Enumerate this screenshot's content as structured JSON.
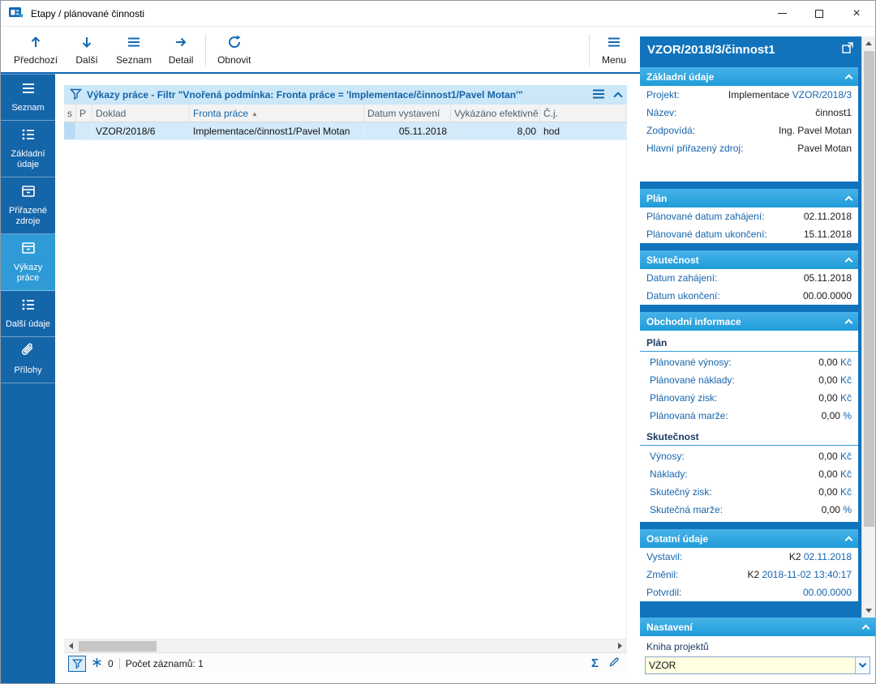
{
  "window": {
    "title": "Etapy / plánované činnosti",
    "controls": {
      "close_glyph": "×"
    }
  },
  "accents": {
    "primary_blue": "#1268B4",
    "sidebar_blue": "#1565A9",
    "sidebar_selected": "#2E9AD6",
    "panel_background": "#1173BC",
    "section_header": "#2AA5DF",
    "filter_bar": "#CBE7F8",
    "row_highlight": "#D3EAFA",
    "combo_background": "#FFFFE1"
  },
  "icons": {
    "close": "×",
    "sort_asc": "▲",
    "sum": "Σ"
  },
  "toolbar": {
    "prev": "Předchozí",
    "next": "Další",
    "list": "Seznam",
    "detail": "Detail",
    "refresh": "Obnovit",
    "menu": "Menu"
  },
  "sidebar": {
    "items": [
      {
        "label": "Seznam",
        "selected": false
      },
      {
        "label": "Základní údaje",
        "selected": false
      },
      {
        "label": "Přiřazené zdroje",
        "selected": false
      },
      {
        "label": "Výkazy práce",
        "selected": true
      },
      {
        "label": "Další údaje",
        "selected": false
      },
      {
        "label": "Přílohy",
        "selected": false
      }
    ]
  },
  "main": {
    "filter": {
      "title": "Výkazy práce",
      "text": " - Filtr \"Vnořená podmínka: Fronta práce = 'Implementace/činnost1/Pavel Motan'\""
    },
    "table": {
      "col_s": "s",
      "col_p": "P",
      "col_doklad": "Doklad",
      "col_fronta": "Fronta práce",
      "sort_asc": "▲",
      "col_datum": "Datum vystavení",
      "col_vykazano": "Vykázáno efektivně",
      "col_cj": "Č.j.",
      "row": {
        "doklad": "VZOR/2018/6",
        "fronta": "Implementace/činnost1/Pavel Motan",
        "datum": "05.11.2018",
        "vykazano": "8,00",
        "cj": "hod"
      }
    },
    "status": {
      "counter": "0",
      "records": "Počet záznamů: 1",
      "sum_glyph": "Σ"
    }
  },
  "panel": {
    "title": "VZOR/2018/3/činnost1",
    "basic": {
      "header": "Základní údaje",
      "rows": [
        {
          "label": "Projekt:",
          "pre": "Implementace ",
          "link": "VZOR/2018/3"
        },
        {
          "label": "Název:",
          "value": "činnost1"
        },
        {
          "label": "Zodpovídá:",
          "value": "Ing. Pavel Motan"
        },
        {
          "label": "Hlavní přiřazený zdroj:",
          "value": "Pavel Motan"
        }
      ]
    },
    "plan": {
      "header": "Plán",
      "rows": [
        {
          "label": "Plánované datum zahájení:",
          "value": "02.11.2018"
        },
        {
          "label": "Plánované datum ukončení:",
          "value": "15.11.2018"
        }
      ]
    },
    "actual": {
      "header": "Skutečnost",
      "rows": [
        {
          "label": "Datum zahájení:",
          "value": "05.11.2018"
        },
        {
          "label": "Datum ukončení:",
          "value": "00.00.0000"
        }
      ]
    },
    "business": {
      "header": "Obchodní informace",
      "plan_sub": "Plán",
      "plan_rows": [
        {
          "label": "Plánované výnosy:",
          "value": "0,00",
          "unit": " Kč"
        },
        {
          "label": "Plánované náklady:",
          "value": "0,00",
          "unit": " Kč"
        },
        {
          "label": "Plánovaný zisk:",
          "value": "0,00",
          "unit": " Kč"
        },
        {
          "label": "Plánovaná marže:",
          "value": "0,00",
          "unit": " %"
        }
      ],
      "actual_sub": "Skutečnost",
      "actual_rows": [
        {
          "label": "Výnosy:",
          "value": "0,00",
          "unit": " Kč"
        },
        {
          "label": "Náklady:",
          "value": "0,00",
          "unit": " Kč"
        },
        {
          "label": "Skutečný zisk:",
          "value": "0,00",
          "unit": " Kč"
        },
        {
          "label": "Skutečná marže:",
          "value": "0,00",
          "unit": " %"
        }
      ]
    },
    "other": {
      "header": "Ostatní údaje",
      "rows": [
        {
          "label": "Vystavil:",
          "pre": "K2 ",
          "link": "02.11.2018"
        },
        {
          "label": "Změnil:",
          "pre": "K2 ",
          "link": "2018-11-02 13:40:17"
        },
        {
          "label": "Potvrdil:",
          "pre": "",
          "link": "00.00.0000"
        }
      ]
    },
    "settings": {
      "header": "Nastavení",
      "book_label": "Kniha projektů",
      "book_value": "VZOR"
    }
  }
}
